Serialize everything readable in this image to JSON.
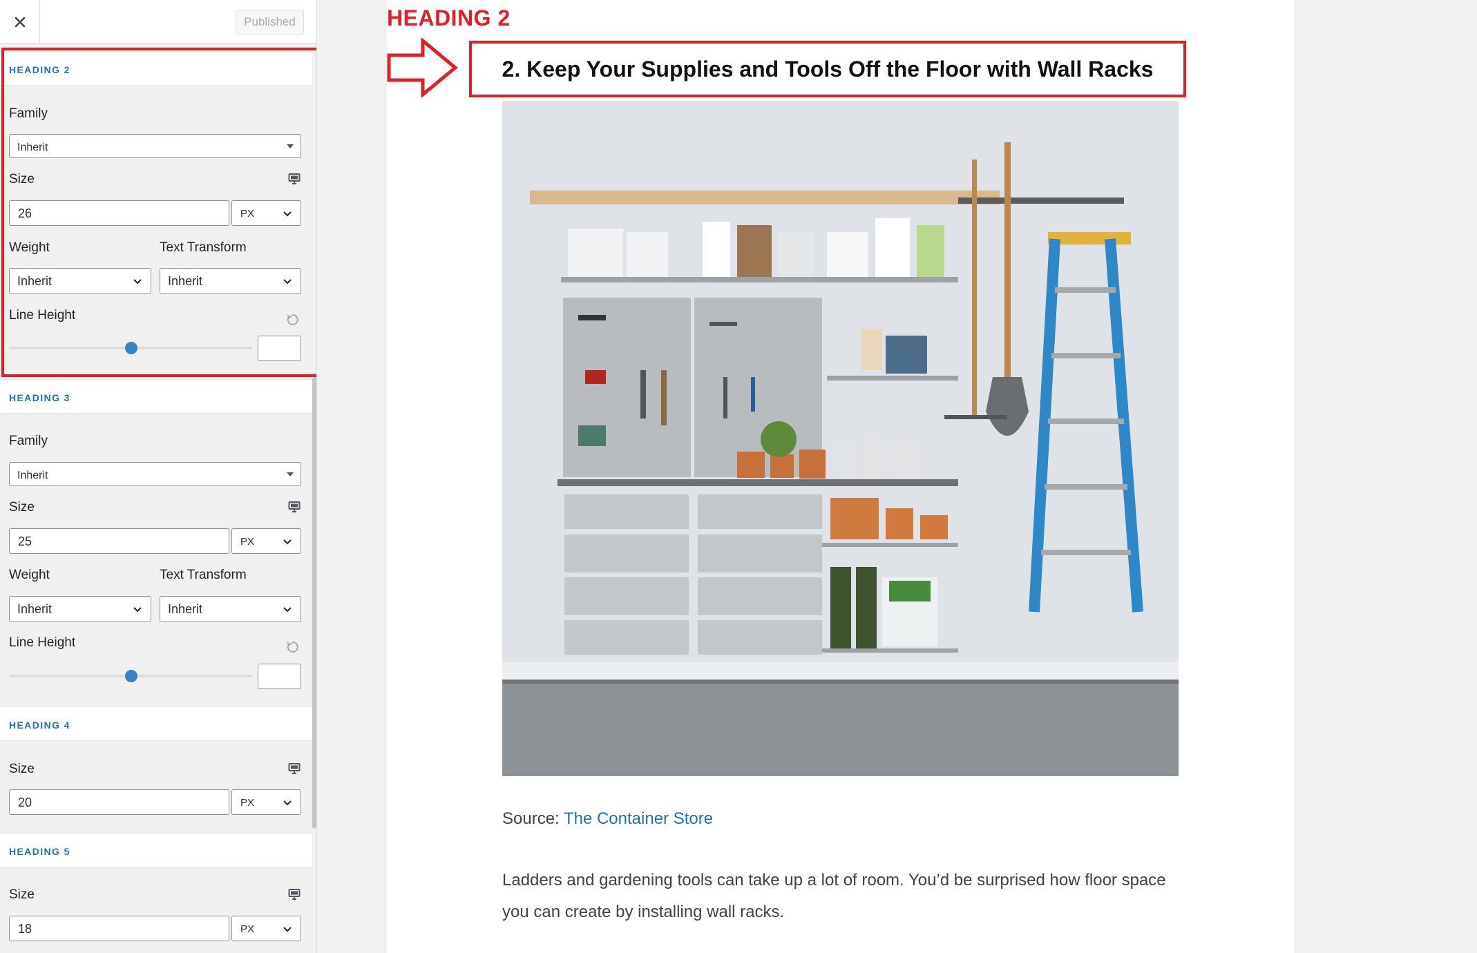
{
  "header": {
    "close_label": "Close",
    "publish_label": "Published"
  },
  "headings": [
    {
      "title": "HEADING 2",
      "family_label": "Family",
      "family_value": "Inherit",
      "size_label": "Size",
      "size_value": "26",
      "size_unit": "PX",
      "weight_label": "Weight",
      "weight_value": "Inherit",
      "transform_label": "Text Transform",
      "transform_value": "Inherit",
      "line_height_label": "Line Height"
    },
    {
      "title": "HEADING 3",
      "family_label": "Family",
      "family_value": "Inherit",
      "size_label": "Size",
      "size_value": "25",
      "size_unit": "PX",
      "weight_label": "Weight",
      "weight_value": "Inherit",
      "transform_label": "Text Transform",
      "transform_value": "Inherit",
      "line_height_label": "Line Height"
    },
    {
      "title": "HEADING 4",
      "size_label": "Size",
      "size_value": "20",
      "size_unit": "PX"
    },
    {
      "title": "HEADING 5",
      "size_label": "Size",
      "size_value": "18",
      "size_unit": "PX"
    }
  ],
  "preview": {
    "annotation_label": "HEADING 2",
    "heading": "2. Keep Your Supplies and Tools Off the Floor with Wall Racks",
    "source_prefix": "Source: ",
    "source_link": "The Container Store",
    "paragraph": "Ladders and gardening tools can take up a lot of room. You’d be surprised how floor space you can create by installing wall racks."
  },
  "icons": {
    "close": "close-icon",
    "device": "desktop-icon",
    "reset": "reset-icon",
    "select": "chevron-down-icon"
  },
  "colors": {
    "accent": "#2271b1",
    "annotation": "#e21f26",
    "slider": "#3582c4"
  },
  "line_height_slider_position": 0.37
}
